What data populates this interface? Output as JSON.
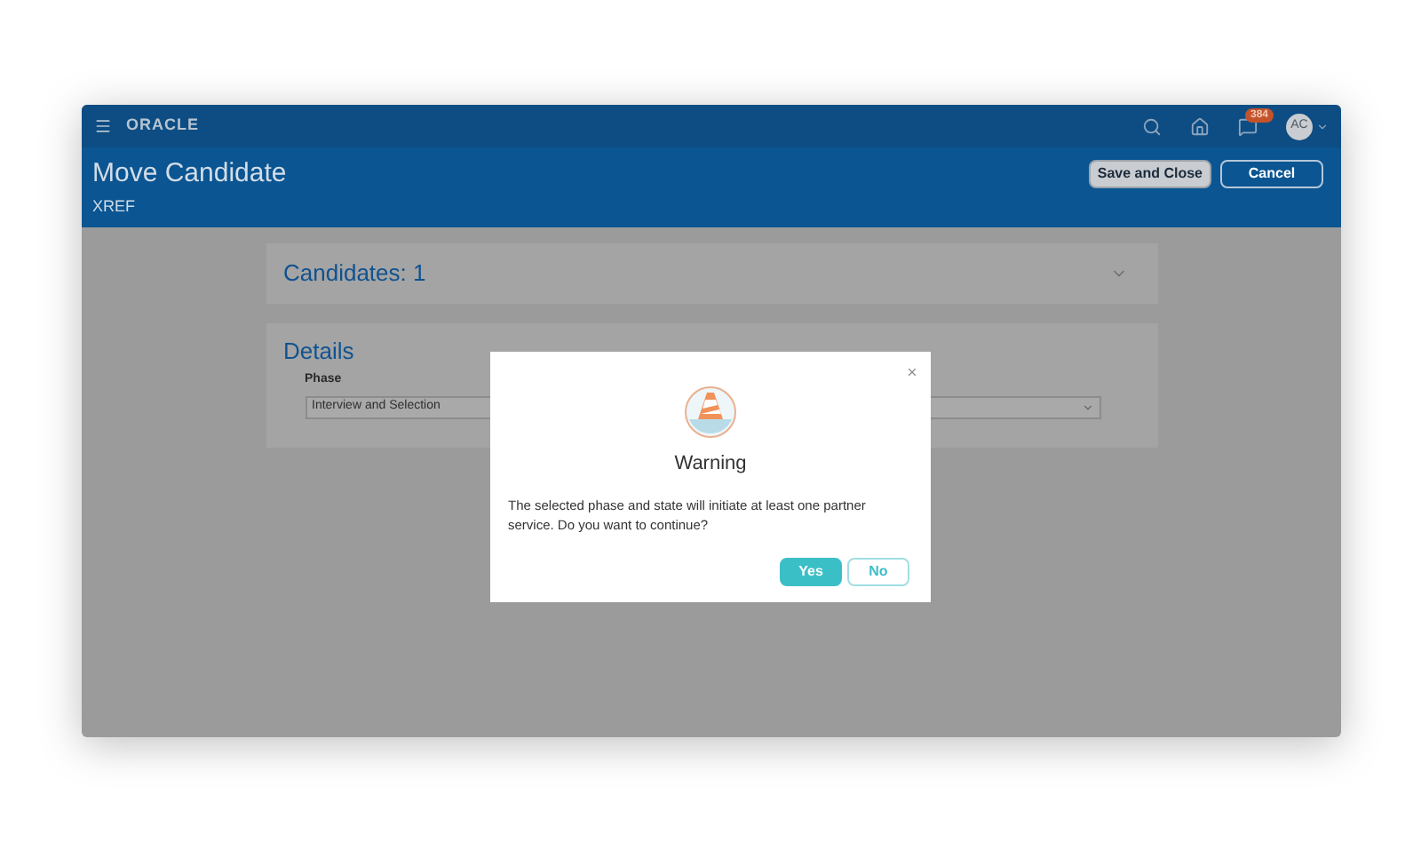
{
  "topbar": {
    "logo": "ORACLE",
    "notification_count": "384",
    "avatar": "AC"
  },
  "header": {
    "title": "Move Candidate",
    "subtitle": "XREF",
    "buttons": [
      {
        "label": "Save and Close",
        "kind": "secondary"
      },
      {
        "label": "Cancel",
        "kind": "outline"
      }
    ]
  },
  "candidates_section": {
    "title": "Candidates: 1",
    "expanded": false
  },
  "details_section": {
    "title": "Details",
    "field": {
      "label": "Phase",
      "value": "Interview and Selection"
    }
  },
  "dialog": {
    "title": "Warning",
    "message": "The selected phase and state will initiate at least one partner service. Do you want to continue?",
    "buttons": [
      {
        "label": "Yes",
        "kind": "primary"
      },
      {
        "label": "No",
        "kind": "outline"
      }
    ]
  }
}
